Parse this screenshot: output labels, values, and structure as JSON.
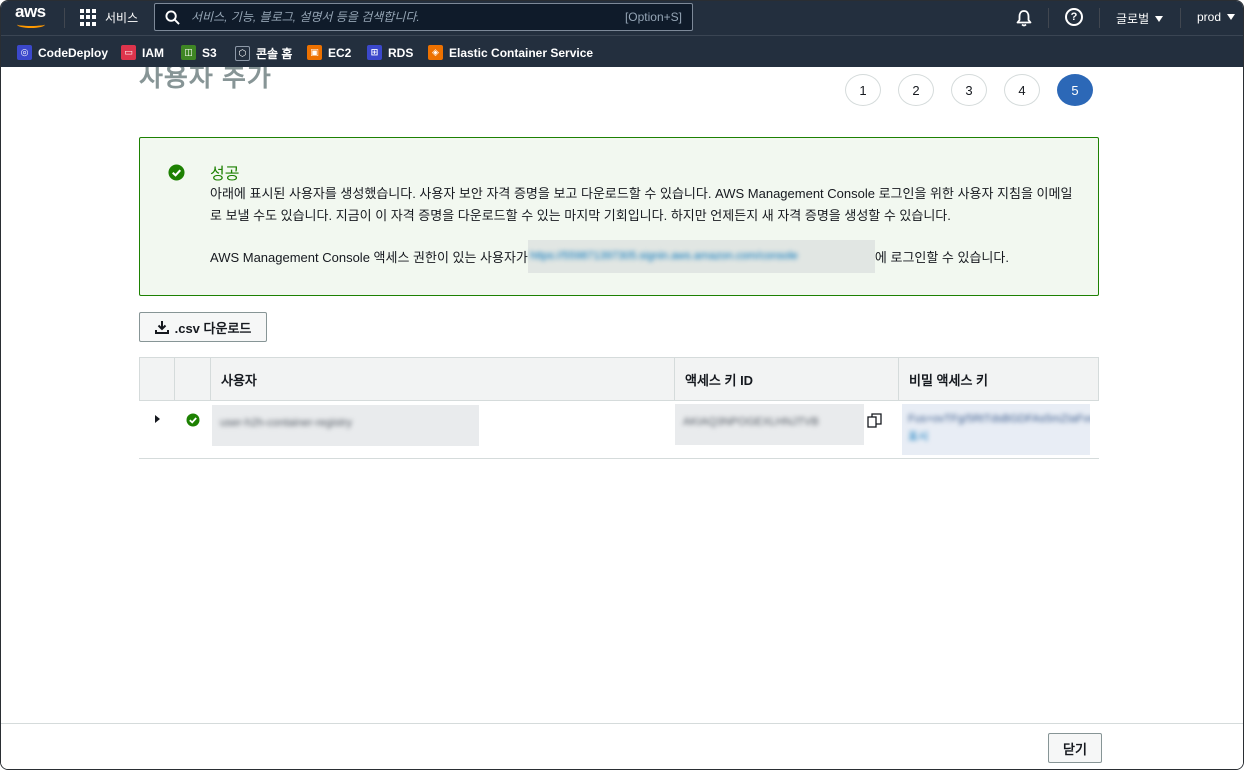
{
  "nav": {
    "logo_text": "aws",
    "services_label": "서비스",
    "search_placeholder": "서비스, 기능, 블로그, 설명서 등을 검색합니다.",
    "search_shortcut": "[Option+S]",
    "region_label": "글로벌",
    "account_label": "prod"
  },
  "favorites": [
    {
      "label": "CodeDeploy",
      "icon": "codedeploy-icon",
      "color": "#3b48cc"
    },
    {
      "label": "IAM",
      "icon": "iam-icon",
      "color": "#dd344c"
    },
    {
      "label": "S3",
      "icon": "s3-icon",
      "color": "#3f8624"
    },
    {
      "label": "콘솔 홈",
      "icon": "console-home-icon",
      "color": "#232f3e"
    },
    {
      "label": "EC2",
      "icon": "ec2-icon",
      "color": "#ed7100"
    },
    {
      "label": "RDS",
      "icon": "rds-icon",
      "color": "#3b48cc"
    },
    {
      "label": "Elastic Container Service",
      "icon": "ecs-icon",
      "color": "#ed7100"
    }
  ],
  "page": {
    "title_partial": "사용자 추가"
  },
  "steps": [
    "1",
    "2",
    "3",
    "4",
    "5"
  ],
  "alert": {
    "title": "성공",
    "body": "아래에 표시된 사용자를 생성했습니다. 사용자 보안 자격 증명을 보고 다운로드할 수 있습니다. AWS Management Console 로그인을 위한 사용자 지침을 이메일로 보낼 수도 있습니다. 지금이 이 자격 증명을 다운로드할 수 있는 마지막 기회입니다. 하지만 언제든지 새 자격 증명을 생성할 수 있습니다.",
    "console_prefix": "AWS Management Console 액세스 권한이 있는 사용자가 ",
    "console_link": "https://559871397305.signin.aws.amazon.com/console",
    "console_suffix": "에 로그인할 수 있습니다."
  },
  "csv_button": ".csv 다운로드",
  "table": {
    "headers": [
      "사용자",
      "액세스 키 ID",
      "비밀 액세스 키"
    ],
    "rows": [
      {
        "user": "user-h2h-container-registry",
        "access_key": "AKIAQ3NPOGEXLHNJTVB",
        "secret_key": "Fus+ovTFg/5RtTdsBGDFAs5mZIaFvwOAkS",
        "secret_show": "표시"
      }
    ]
  },
  "footer": {
    "close_label": "닫기"
  }
}
